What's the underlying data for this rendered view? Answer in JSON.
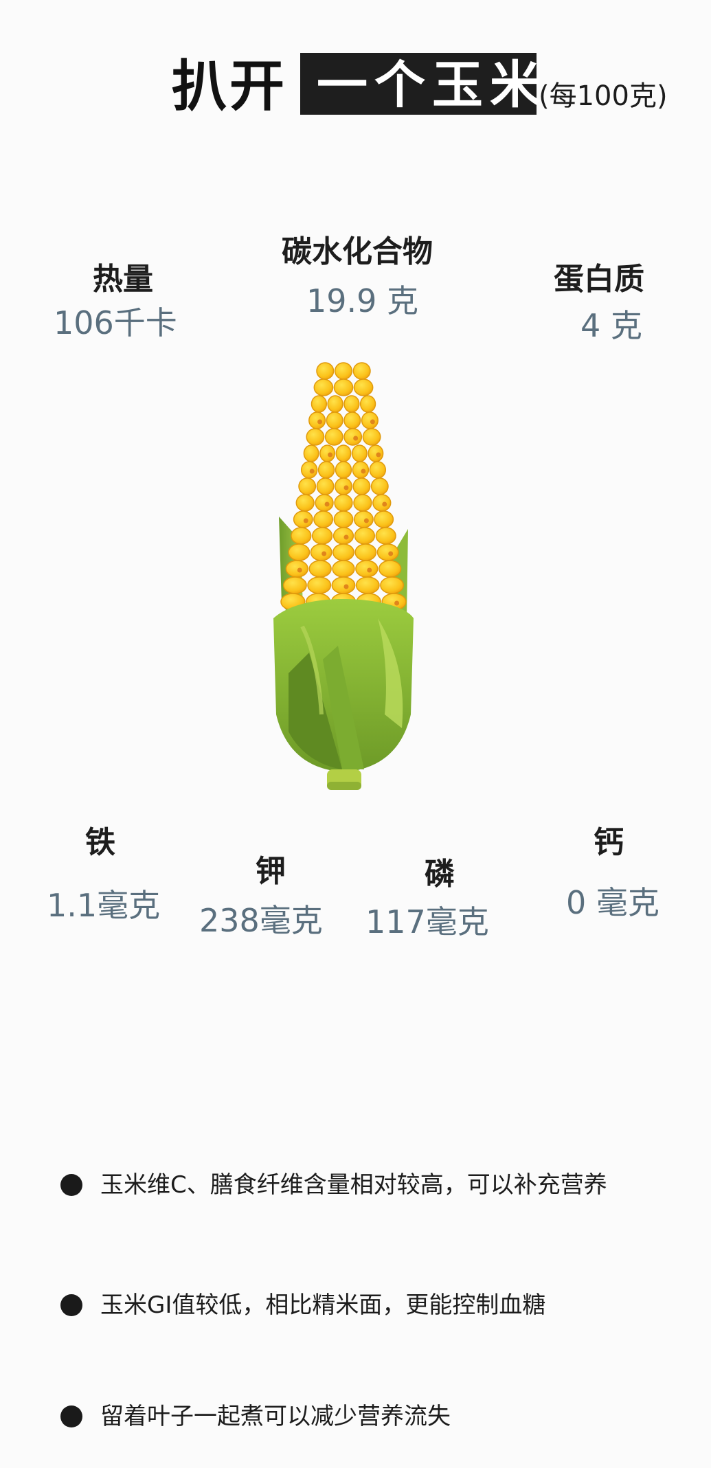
{
  "title": {
    "prefix": "扒开",
    "highlight": "一个玉米",
    "note": "(每100克)"
  },
  "nutrients": {
    "calories": {
      "label": "热量",
      "value": "106千卡"
    },
    "carbs": {
      "label": "碳水化合物",
      "value": "19.9 克"
    },
    "protein": {
      "label": "蛋白质",
      "value": "4 克"
    },
    "iron": {
      "label": "铁",
      "value": "1.1毫克"
    },
    "potassium": {
      "label": "钾",
      "value": "238毫克"
    },
    "phosphorus": {
      "label": "磷",
      "value": "117毫克"
    },
    "calcium": {
      "label": "钙",
      "value": "0 毫克"
    }
  },
  "notes": [
    "玉米维C、膳食纤维含量相对较高，可以补充营养",
    "玉米GI值较低，相比精米面，更能控制血糖",
    "留着叶子一起煮可以减少营养流失"
  ],
  "colors": {
    "value_text": "#5a6f7e",
    "kernel": "#fbc21a",
    "husk": "#8cbf3a"
  }
}
